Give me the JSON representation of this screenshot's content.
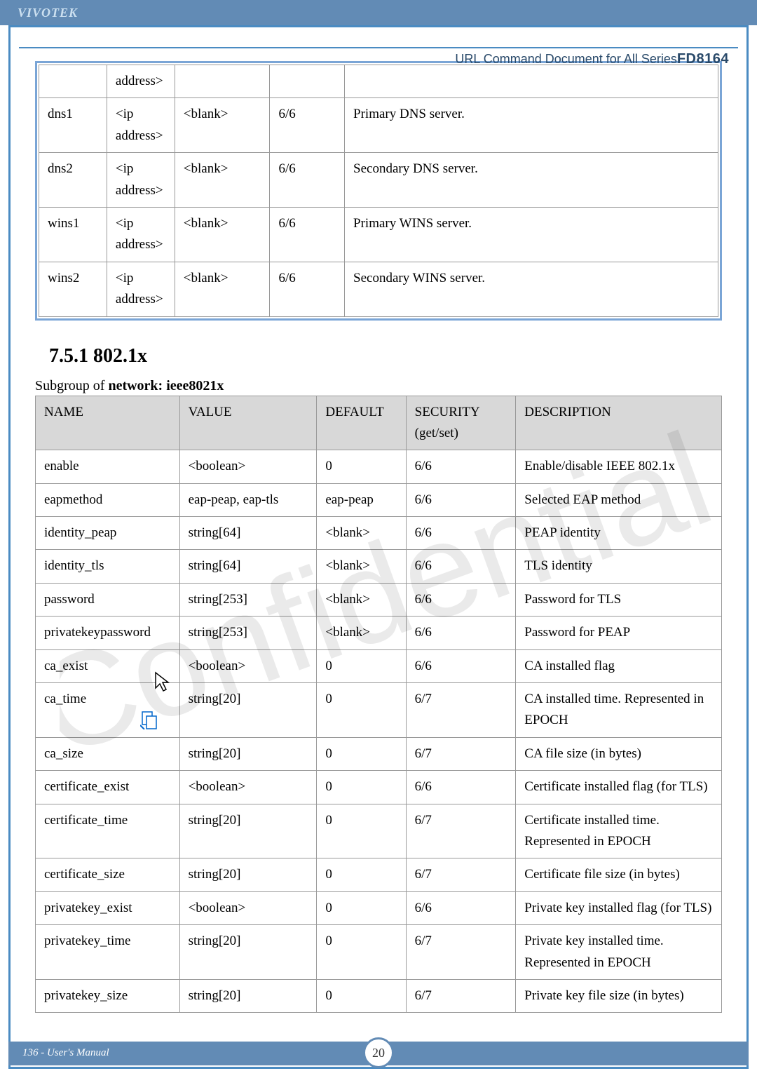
{
  "header": {
    "logo": "VIVOTEK",
    "url_cmd_prefix": "URL Command Document for All Series",
    "model": "FD8164"
  },
  "table1": {
    "rows": [
      {
        "c1": "",
        "c2": "address>",
        "c3": "",
        "c4": "",
        "c5": ""
      },
      {
        "c1": "dns1",
        "c2": "<ip address>",
        "c3": "<blank>",
        "c4": "6/6",
        "c5": "Primary DNS server."
      },
      {
        "c1": "dns2",
        "c2": "<ip address>",
        "c3": "<blank>",
        "c4": "6/6",
        "c5": "Secondary DNS server."
      },
      {
        "c1": "wins1",
        "c2": "<ip address>",
        "c3": "<blank>",
        "c4": "6/6",
        "c5": "Primary WINS server."
      },
      {
        "c1": "wins2",
        "c2": "<ip address>",
        "c3": "<blank>",
        "c4": "6/6",
        "c5": "Secondary WINS server."
      }
    ]
  },
  "section": {
    "heading": "7.5.1 802.1x",
    "subgroup_prefix": "Subgroup of ",
    "subgroup_name": "network: ieee8021x"
  },
  "table2": {
    "headers": {
      "h1": "NAME",
      "h2": "VALUE",
      "h3": "DEFAULT",
      "h4": "SECURITY (get/set)",
      "h5": "DESCRIPTION"
    },
    "rows": [
      {
        "name": "enable",
        "value": "<boolean>",
        "default": "0",
        "security": "6/6",
        "desc": "Enable/disable IEEE 802.1x"
      },
      {
        "name": "eapmethod",
        "value": "eap-peap, eap-tls",
        "default": "eap-peap",
        "security": "6/6",
        "desc": "Selected EAP method"
      },
      {
        "name": "identity_peap",
        "value": "string[64]",
        "default": "<blank>",
        "security": "6/6",
        "desc": "PEAP identity"
      },
      {
        "name": "identity_tls",
        "value": "string[64]",
        "default": "<blank>",
        "security": "6/6",
        "desc": "TLS identity"
      },
      {
        "name": "password",
        "value": "string[253]",
        "default": "<blank>",
        "security": "6/6",
        "desc": "Password for TLS"
      },
      {
        "name": "privatekeypassword",
        "value": "string[253]",
        "default": "<blank>",
        "security": "6/6",
        "desc": "Password for PEAP"
      },
      {
        "name": "ca_exist",
        "value": "<boolean>",
        "default": "0",
        "security": "6/6",
        "desc": "CA installed flag"
      },
      {
        "name": "ca_time",
        "value": "string[20]",
        "default": "0",
        "security": "6/7",
        "desc": "CA installed time. Represented in EPOCH"
      },
      {
        "name": "ca_size",
        "value": "string[20]",
        "default": "0",
        "security": "6/7",
        "desc": "CA file size (in bytes)"
      },
      {
        "name": "certificate_exist",
        "value": "<boolean>",
        "default": "0",
        "security": "6/6",
        "desc": "Certificate installed flag (for TLS)"
      },
      {
        "name": "certificate_time",
        "value": "string[20]",
        "default": "0",
        "security": "6/7",
        "desc": "Certificate installed time. Represented in EPOCH"
      },
      {
        "name": "certificate_size",
        "value": "string[20]",
        "default": "0",
        "security": "6/7",
        "desc": "Certificate file size (in bytes)"
      },
      {
        "name": "privatekey_exist",
        "value": "<boolean>",
        "default": "0",
        "security": "6/6",
        "desc": "Private key installed flag (for TLS)"
      },
      {
        "name": "privatekey_time",
        "value": "string[20]",
        "default": "0",
        "security": "6/7",
        "desc": "Private key installed time. Represented in EPOCH"
      },
      {
        "name": "privatekey_size",
        "value": "string[20]",
        "default": "0",
        "security": "6/7",
        "desc": "Private key file size (in bytes)"
      }
    ]
  },
  "footer": {
    "left": "136 - User's Manual",
    "page": "20"
  }
}
